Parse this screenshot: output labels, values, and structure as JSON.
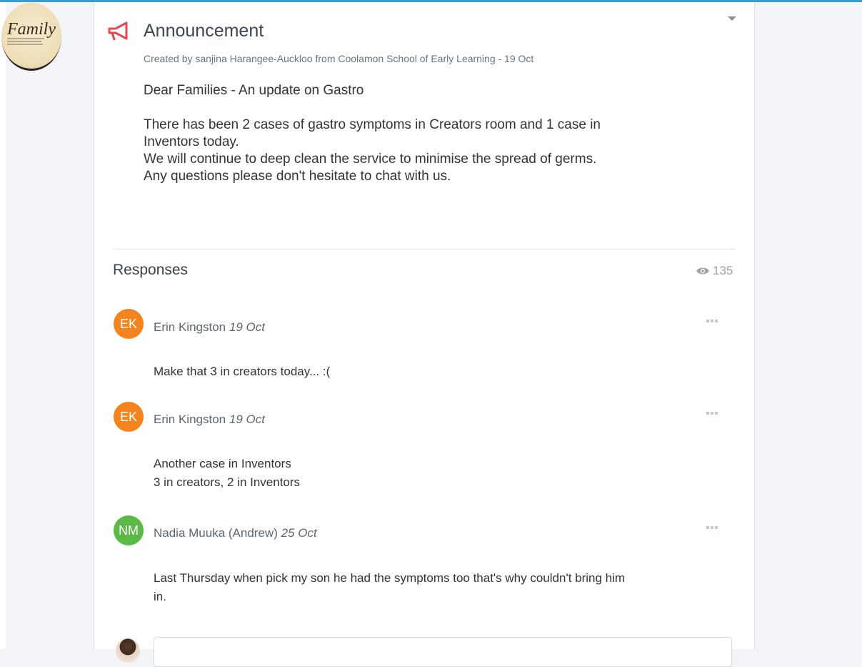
{
  "profile": {
    "logo_text": "Family"
  },
  "announcement": {
    "title": "Announcement",
    "meta": "Created by sanjina Harangee-Auckloo from Coolamon School of Early Learning - 19 Oct",
    "heading_line": "Dear Families - An update on Gastro",
    "lines": [
      "There has been 2 cases of gastro symptoms in Creators room and 1 case in",
      "Inventors today.",
      "We will continue to deep clean the service to minimise the spread of germs.",
      "Any questions please don't hesitate to chat with us."
    ]
  },
  "responses": {
    "title": "Responses",
    "view_count": "135",
    "items": [
      {
        "initials": "EK",
        "color": "#f5841f",
        "name": "Erin Kingston",
        "date": "19 Oct",
        "lines": [
          "Make that 3 in creators today... :("
        ]
      },
      {
        "initials": "EK",
        "color": "#f5841f",
        "name": "Erin Kingston",
        "date": "19 Oct",
        "lines": [
          "Another case in Inventors",
          "3 in creators, 2 in Inventors"
        ]
      },
      {
        "initials": "NM",
        "color": "#5bb946",
        "name": "Nadia Muuka (Andrew)",
        "date": "25 Oct",
        "lines": [
          "Last Thursday when pick my son he had the symptoms too that's why couldn't bring him",
          "in."
        ]
      }
    ]
  },
  "colors": {
    "accent": "#3a9bd5",
    "megaphone": "#e5484d"
  },
  "icons": {
    "announcement": "megaphone-icon",
    "views": "eye-icon",
    "menu": "more-dots-icon",
    "collapse": "caret-down-icon"
  }
}
